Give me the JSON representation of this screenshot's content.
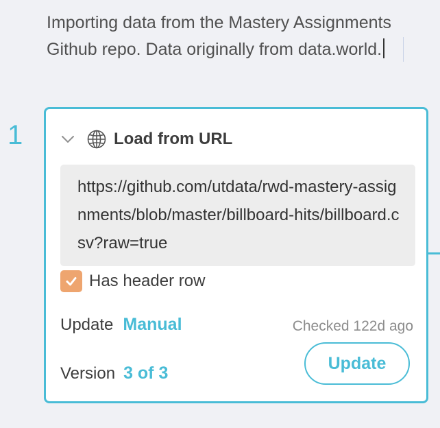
{
  "note": {
    "text": "Importing data from the Mastery Assignments Github repo. Data originally from data.world."
  },
  "step": {
    "number": "1",
    "title": "Load from URL",
    "icons": {
      "collapse": "chevron-down-icon",
      "type": "globe-icon",
      "checkbox": "checkmark-icon"
    },
    "url": "https://github.com/utdata/rwd-mastery-assignments/blob/master/billboard-hits/billboard.csv?raw=true",
    "has_header_row": {
      "label": "Has header row",
      "checked": true
    },
    "update": {
      "label": "Update",
      "value": "Manual"
    },
    "checked_status": "Checked 122d ago",
    "version": {
      "label": "Version",
      "value": "3 of 3"
    },
    "update_button_label": "Update"
  },
  "colors": {
    "accent": "#49bcd6",
    "checkbox": "#eea56f",
    "background": "#f0f1f5",
    "url_box": "#ededed"
  }
}
